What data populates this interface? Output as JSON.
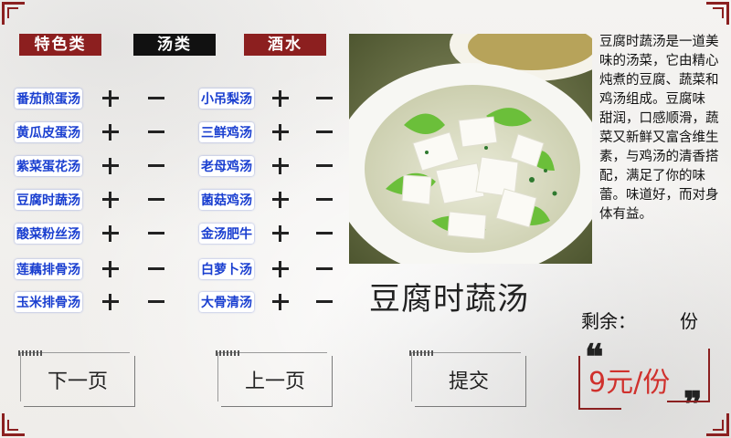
{
  "tabs": {
    "specialty": "特色类",
    "soup": "汤类",
    "drinks": "酒水"
  },
  "menu": {
    "left_items": [
      "番茄煎蛋汤",
      "黄瓜皮蛋汤",
      "紫菜蛋花汤",
      "豆腐时蔬汤",
      "酸菜粉丝汤",
      "莲藕排骨汤",
      "玉米排骨汤"
    ],
    "right_items": [
      "小吊梨汤",
      "三鲜鸡汤",
      "老母鸡汤",
      "菌菇鸡汤",
      "金汤肥牛",
      "白萝卜汤",
      "大骨清汤"
    ]
  },
  "detail": {
    "description": "豆腐时蔬汤是一道美味的汤菜，它由精心炖煮的豆腐、蔬菜和鸡汤组成。豆腐味  甜润，口感顺滑，蔬菜又新鲜又富含维生素，与鸡汤的清香搭配，满足了你的味蕾。味道好，而对身体有益。",
    "dish_name": "豆腐时蔬汤",
    "stock_label": "剩余：",
    "stock_unit": "份",
    "price": "9元/份",
    "quote_open": "❝",
    "quote_close": "❞"
  },
  "nav": {
    "next": "下一页",
    "prev": "上一页",
    "submit": "提交"
  },
  "colors": {
    "tab_red": "#8c1f1f",
    "tab_black": "#111111",
    "item_text": "#1a3fd0",
    "price": "#d0312d",
    "frame": "#8b2020"
  }
}
